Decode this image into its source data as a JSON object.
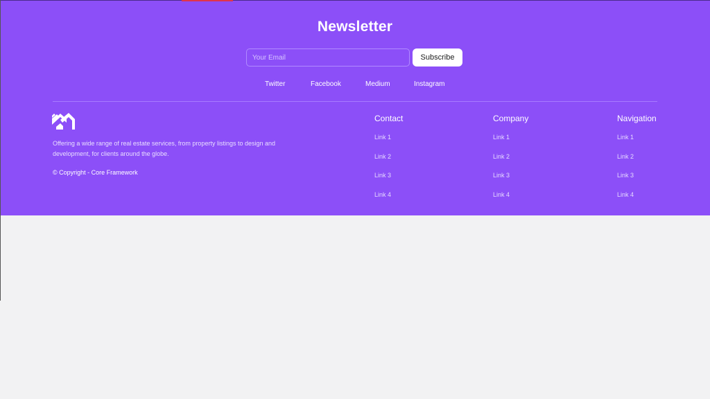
{
  "newsletter": {
    "title": "Newsletter",
    "email_placeholder": "Your Email",
    "subscribe_label": "Subscribe"
  },
  "social": [
    "Twitter",
    "Facebook",
    "Medium",
    "Instagram"
  ],
  "about": {
    "logo_icon": "house-roof-icon",
    "description": "Offering a wide range of real estate services, from property listings to design and development, for clients around the globe.",
    "copyright": "© Copyright - Core Framework"
  },
  "columns": [
    {
      "title": "Contact",
      "links": [
        "Link 1",
        "Link 2",
        "Link 3",
        "Link 4"
      ]
    },
    {
      "title": "Company",
      "links": [
        "Link 1",
        "Link 2",
        "Link 3",
        "Link 4"
      ]
    },
    {
      "title": "Navigation",
      "links": [
        "Link 1",
        "Link 2",
        "Link 3",
        "Link 4"
      ]
    }
  ],
  "colors": {
    "footer_bg": "#8c4ff8",
    "page_bg": "#f2f2f3",
    "button_bg": "#ffffff"
  }
}
